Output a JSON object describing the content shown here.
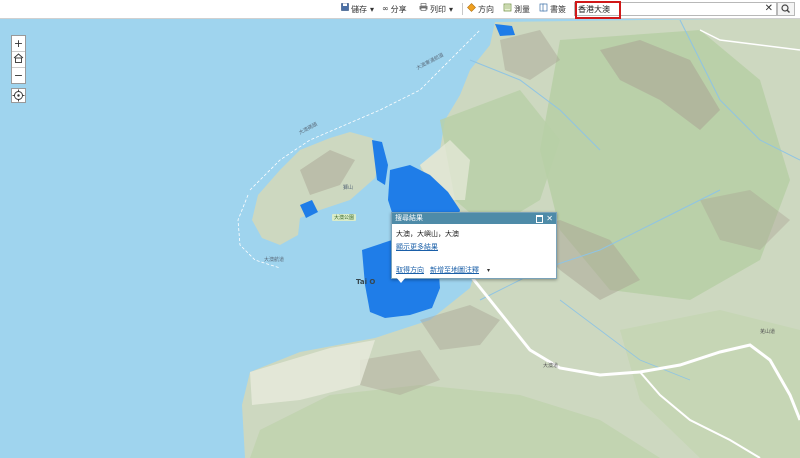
{
  "toolbar": {
    "save_label": "儲存",
    "share_label": "分享",
    "print_label": "列印",
    "directions_label": "方向",
    "measure_label": "測量",
    "bookmarks_label": "書簽",
    "dropdown_glyph": "▾"
  },
  "search": {
    "value": "香港大澳",
    "clear_glyph": "✕"
  },
  "zoom": {
    "in_label": "+",
    "out_label": "−"
  },
  "map_labels": {
    "channel_north": "大澳東涌航道",
    "channel_south": "大澳航道",
    "channel_west": "大澳碼頭",
    "peak": "獅山",
    "park": "大澳公園",
    "place": "Tai O",
    "road": "大澳道",
    "road_east": "羌山道"
  },
  "popup": {
    "title": "搜尋結果",
    "result_text": "大澳，大嶼山，大澳",
    "more_results": "顯示更多結果",
    "directions_link": "取得方向",
    "add_to_map_link": "新增至地圖注釋",
    "more_arrow": "▾"
  },
  "colors": {
    "sea": "#9fd4ee",
    "land": "#cdd8c0",
    "forest": "#b8cfa6",
    "ridge": "#a7a093",
    "water_highlight": "#1f7de8",
    "popup_header": "#4e8ba8",
    "link": "#1a5fa8",
    "highlight_box": "#d01818"
  },
  "icons": {
    "save": "floppy-disk-icon",
    "share": "share-link-icon",
    "print": "printer-icon",
    "directions": "directions-diamond-icon",
    "measure": "measure-ruler-icon",
    "bookmarks": "bookmark-icon",
    "search": "magnifier-icon",
    "home": "home-icon",
    "locate": "locate-target-icon"
  }
}
